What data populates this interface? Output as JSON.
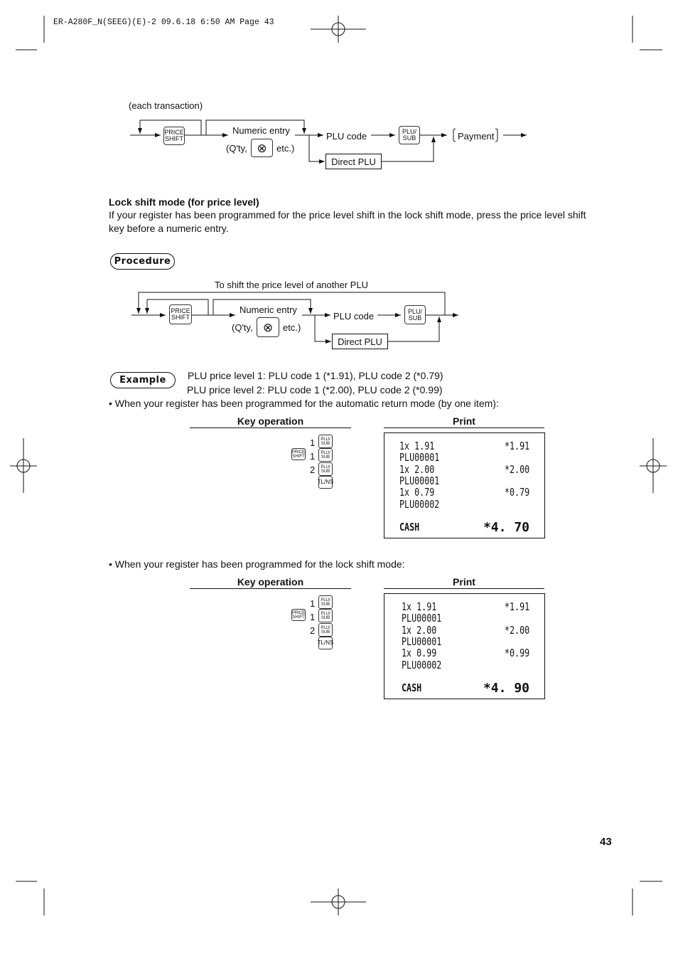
{
  "header": {
    "slug": "ER-A280F_N(SEEG)(E)-2  09.6.18 6:50 AM  Page 43"
  },
  "diagram1": {
    "note": "(each transaction)",
    "price_shift_key": [
      "PRICE",
      "SHIFT"
    ],
    "numeric_entry": "Numeric entry",
    "qty_prefix": "(Q'ty,",
    "qty_suffix": "etc.)",
    "multiply_key": "⊗",
    "plu_code": "PLU code",
    "plu_sub_key": [
      "PLU/",
      "SUB"
    ],
    "direct_plu": "Direct PLU",
    "payment": "Payment"
  },
  "lock_shift": {
    "title": "Lock shift mode (for price level)",
    "body": "If your register has been programmed for the price level shift in the lock shift mode, press the price level shift key before a numeric entry."
  },
  "procedure_label": "Procedure",
  "diagram2": {
    "loop_label": "To shift the price level of another PLU",
    "price_shift_key": [
      "PRICE",
      "SHIFT"
    ],
    "numeric_entry": "Numeric entry",
    "qty_prefix": "(Q'ty,",
    "qty_suffix": "etc.)",
    "multiply_key": "⊗",
    "plu_code": "PLU code",
    "plu_sub_key": [
      "PLU/",
      "SUB"
    ],
    "direct_plu": "Direct PLU"
  },
  "example_label": "Example",
  "example_lines": [
    "PLU price level 1: PLU code 1 (*1.91), PLU code 2 (*0.79)",
    "PLU price level 2: PLU code 1 (*2.00), PLU code 2 (*0.99)"
  ],
  "sections": [
    {
      "bullet": "• When your register has been programmed for the automatic return mode (by one item):",
      "key_header": "Key operation",
      "print_header": "Print",
      "keys": {
        "d1": "1",
        "d2": "1",
        "d3": "2",
        "plu": [
          "PLU/",
          "SUB"
        ],
        "shift": [
          "PRICE",
          "SHIFT"
        ],
        "tl": "TL/NS"
      },
      "receipt": [
        [
          "1x 1.91",
          "*1.91"
        ],
        [
          "PLU00001",
          ""
        ],
        [
          "1x 2.00",
          "*2.00"
        ],
        [
          "PLU00001",
          ""
        ],
        [
          "1x 0.79",
          "*0.79"
        ],
        [
          "PLU00002",
          ""
        ]
      ],
      "total": [
        "CASH",
        "*4. 70"
      ]
    },
    {
      "bullet": "• When your register has been programmed for the lock shift mode:",
      "key_header": "Key operation",
      "print_header": "Print",
      "keys": {
        "d1": "1",
        "d2": "1",
        "d3": "2",
        "plu": [
          "PLU/",
          "SUB"
        ],
        "shift": [
          "PRICE",
          "SHIFT"
        ],
        "tl": "TL/NS"
      },
      "receipt": [
        [
          "1x 1.91",
          "*1.91"
        ],
        [
          "PLU00001",
          ""
        ],
        [
          "1x 2.00",
          "*2.00"
        ],
        [
          "PLU00001",
          ""
        ],
        [
          "1x 0.99",
          "*0.99"
        ],
        [
          "PLU00002",
          ""
        ]
      ],
      "total": [
        "CASH",
        "*4. 90"
      ]
    }
  ],
  "page_number": "43"
}
